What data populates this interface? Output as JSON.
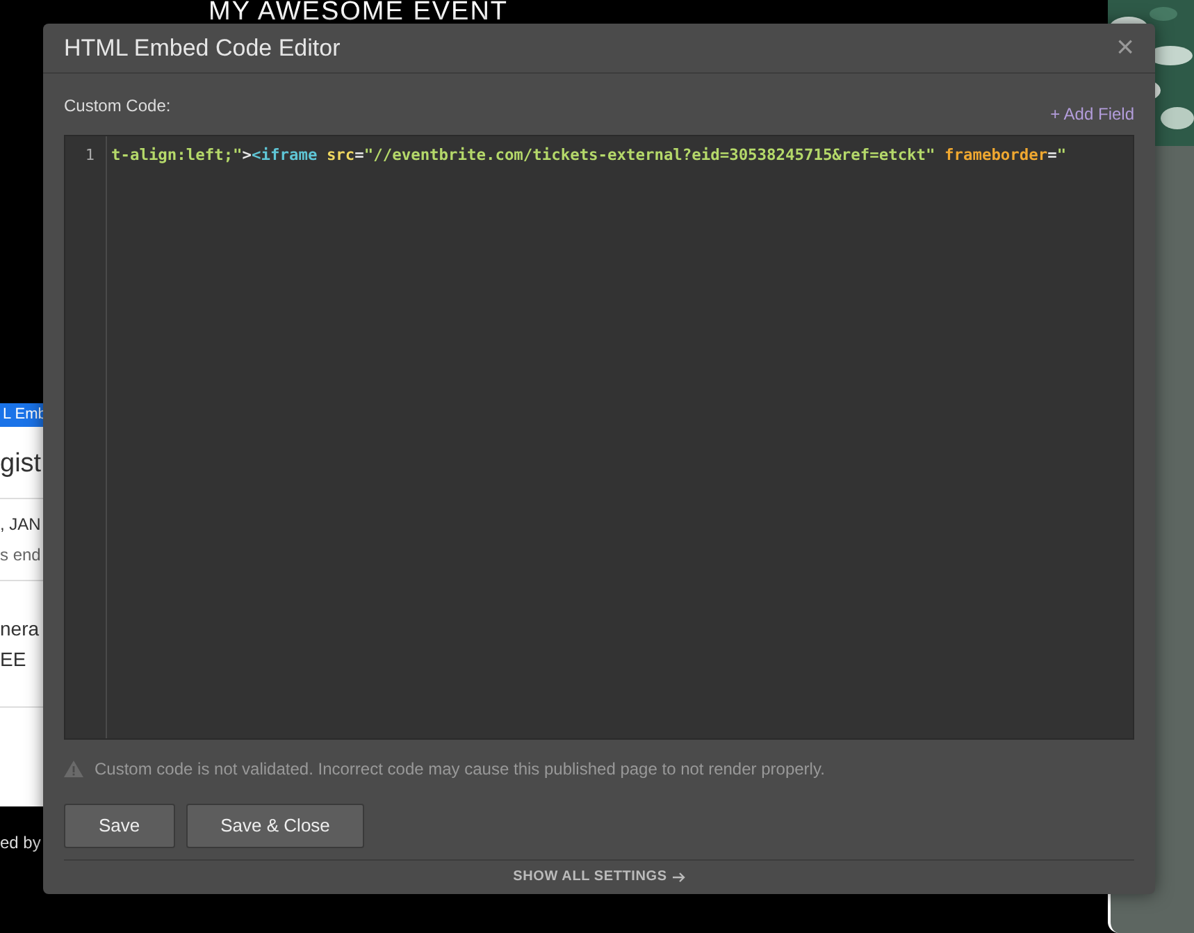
{
  "background": {
    "heading": "MY AWESOME EVENT",
    "tag": "L Emb",
    "panel_title": "gist",
    "date": ", JAN",
    "note": "s end",
    "ticket_name": "nera",
    "ticket_price": "EE",
    "footer": "ed by"
  },
  "dialog": {
    "title": "HTML Embed Code Editor",
    "close": "×",
    "field_label": "Custom Code:",
    "add_field": "+ Add Field",
    "editor": {
      "lines": [
        {
          "number": "1",
          "tokens": [
            {
              "kind": "string",
              "text": "t-align:left;\""
            },
            {
              "kind": "punct",
              "text": ">"
            },
            {
              "kind": "tag",
              "text": "<iframe"
            },
            {
              "kind": "attr",
              "text": " src"
            },
            {
              "kind": "punct",
              "text": "="
            },
            {
              "kind": "string",
              "text": "\"//eventbrite.com/tickets-external?eid=30538245715&ref=etckt\""
            },
            {
              "kind": "attr2",
              "text": " frameborder"
            },
            {
              "kind": "punct",
              "text": "="
            },
            {
              "kind": "string",
              "text": "\""
            }
          ]
        }
      ]
    },
    "warning": "Custom code is not validated. Incorrect code may cause this published page to not render properly.",
    "buttons": [
      "Save",
      "Save & Close"
    ],
    "footer_link": "SHOW ALL SETTINGS"
  }
}
